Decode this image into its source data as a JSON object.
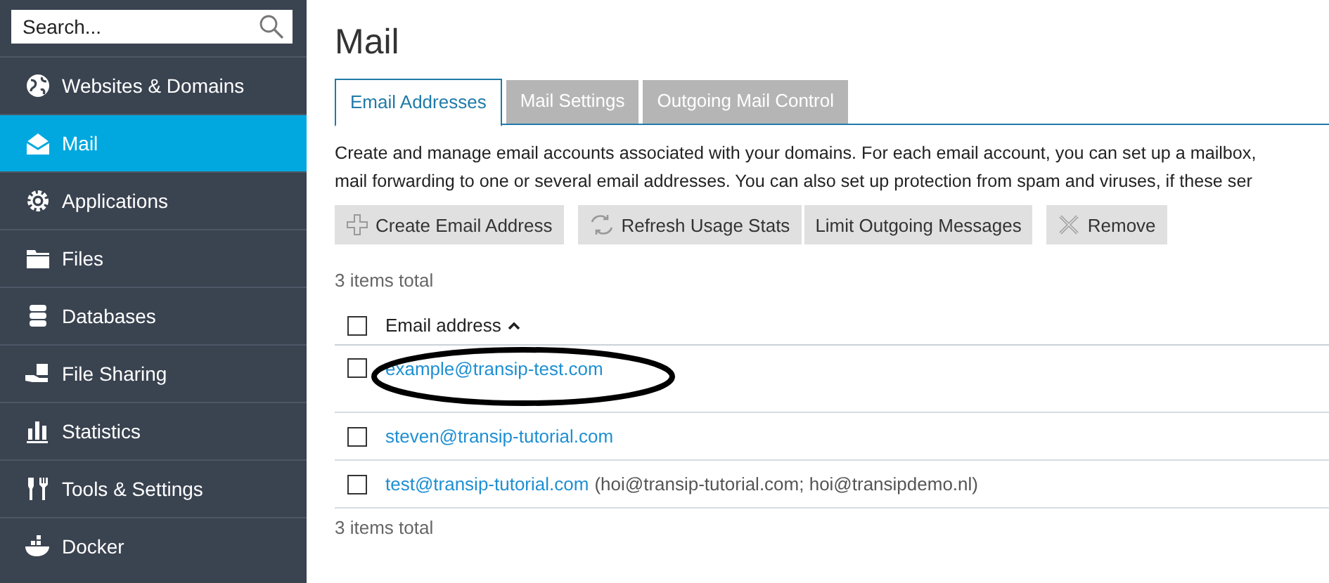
{
  "sidebar": {
    "search": {
      "placeholder": "Search..."
    },
    "items": [
      {
        "label": "Websites & Domains",
        "selected": false
      },
      {
        "label": "Mail",
        "selected": true
      },
      {
        "label": "Applications",
        "selected": false
      },
      {
        "label": "Files",
        "selected": false
      },
      {
        "label": "Databases",
        "selected": false
      },
      {
        "label": "File Sharing",
        "selected": false
      },
      {
        "label": "Statistics",
        "selected": false
      },
      {
        "label": "Tools & Settings",
        "selected": false
      },
      {
        "label": "Docker",
        "selected": false
      }
    ]
  },
  "page_title": "Mail",
  "tabs": [
    {
      "label": "Email Addresses",
      "selected": true
    },
    {
      "label": "Mail Settings",
      "selected": false
    },
    {
      "label": "Outgoing Mail Control",
      "selected": false
    }
  ],
  "description": [
    "Create and manage email accounts associated with your domains. For each email account, you can set up a mailbox,",
    "mail forwarding to one or several email addresses. You can also set up protection from spam and viruses, if these ser"
  ],
  "toolbar": [
    {
      "label": "Create Email Address"
    },
    {
      "label": "Refresh Usage Stats"
    },
    {
      "label": "Limit Outgoing Messages"
    },
    {
      "label": "Remove"
    }
  ],
  "items_total_top": "3 items total",
  "table": {
    "column": "Email address",
    "header_checked": false,
    "rows": [
      {
        "email": "example@transip-test.com",
        "checked": false,
        "circled": true
      },
      {
        "email": "steven@transip-tutorial.com",
        "checked": false,
        "circled": false
      },
      {
        "email": "test@transip-tutorial.com",
        "forwards": "(hoi@transip-tutorial.com; hoi@transipdemo.nl)",
        "checked": false,
        "circled": false
      }
    ]
  },
  "items_total_bottom": "3 items total"
}
